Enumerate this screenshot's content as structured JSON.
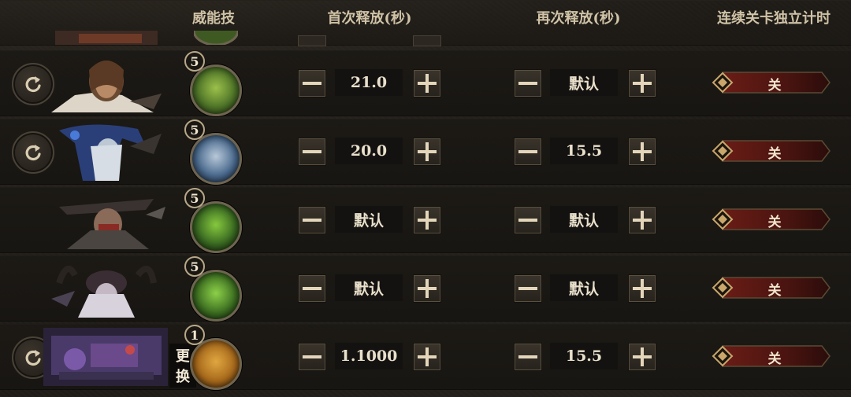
{
  "header": {
    "skill_col": "威能技",
    "first_release_col": "首次释放(秒)",
    "again_release_col": "再次释放(秒)",
    "stage_timer_col": "连续关卡独立计时"
  },
  "colors": {
    "background": "#1f1c18",
    "toggle_off": "#5a1814",
    "accent_gold": "#c9a76a"
  },
  "rows": [
    {
      "has_refresh": true,
      "portrait_icon": "hero-portrait-warrior",
      "skill_level": "5",
      "skill_icon": "green-beast-skill-icon",
      "first_release": "21.0",
      "again_release": "默认",
      "stage_timer": "关"
    },
    {
      "has_refresh": true,
      "portrait_icon": "hero-portrait-frost-mage",
      "skill_level": "5",
      "skill_icon": "blue-blade-skill-icon",
      "first_release": "20.0",
      "again_release": "15.5",
      "stage_timer": "关"
    },
    {
      "has_refresh": false,
      "portrait_icon": "hero-portrait-gunslinger",
      "skill_level": "5",
      "skill_icon": "green-claw-skill-icon",
      "first_release": "默认",
      "again_release": "默认",
      "stage_timer": "关"
    },
    {
      "has_refresh": false,
      "portrait_icon": "hero-portrait-horned-sorceress",
      "skill_level": "5",
      "skill_icon": "green-thorn-skill-icon",
      "first_release": "默认",
      "again_release": "默认",
      "stage_timer": "关"
    },
    {
      "has_refresh": true,
      "portrait_icon": "hero-portrait-mechanic",
      "portrait_tag": "更换",
      "skill_level": "1",
      "skill_icon": "gold-rune-skill-icon",
      "first_release": "1.1000",
      "again_release": "15.5",
      "stage_timer": "关"
    }
  ]
}
